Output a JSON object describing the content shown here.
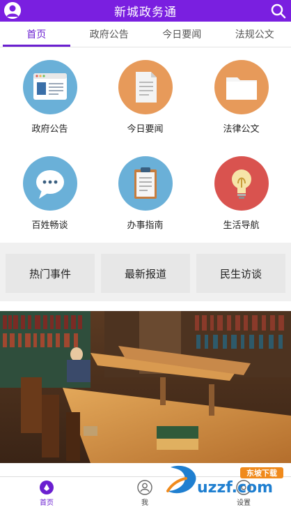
{
  "header": {
    "title": "新城政务通",
    "avatar_icon": "user-avatar-icon",
    "search_icon": "search-icon"
  },
  "tabs": [
    {
      "label": "首页",
      "active": true
    },
    {
      "label": "政府公告",
      "active": false
    },
    {
      "label": "今日要闻",
      "active": false
    },
    {
      "label": "法规公文",
      "active": false
    }
  ],
  "grid": [
    {
      "label": "政府公告",
      "icon": "browser-window-icon",
      "color": "#6ab0d8"
    },
    {
      "label": "今日要闻",
      "icon": "document-icon",
      "color": "#e79a5a"
    },
    {
      "label": "法律公文",
      "icon": "folder-icon",
      "color": "#e79a5a"
    },
    {
      "label": "百姓畅谈",
      "icon": "chat-bubble-icon",
      "color": "#6ab0d8"
    },
    {
      "label": "办事指南",
      "icon": "clipboard-icon",
      "color": "#6ab0d8"
    },
    {
      "label": "生活导航",
      "icon": "lightbulb-icon",
      "color": "#d9534f"
    }
  ],
  "quick_links": [
    {
      "label": "热门事件"
    },
    {
      "label": "最新报道"
    },
    {
      "label": "民生访谈"
    }
  ],
  "banner": {
    "icon": "library-photo"
  },
  "bottom_nav": [
    {
      "label": "首页",
      "icon": "home-icon",
      "active": true
    },
    {
      "label": "我",
      "icon": "profile-icon",
      "active": false
    },
    {
      "label": "设置",
      "icon": "settings-icon",
      "active": false
    }
  ],
  "watermark": {
    "text": "uzzf.com",
    "subtext": "东坡下载"
  },
  "colors": {
    "brand": "#7a1fe0",
    "tab_active": "#6a1fd0"
  }
}
